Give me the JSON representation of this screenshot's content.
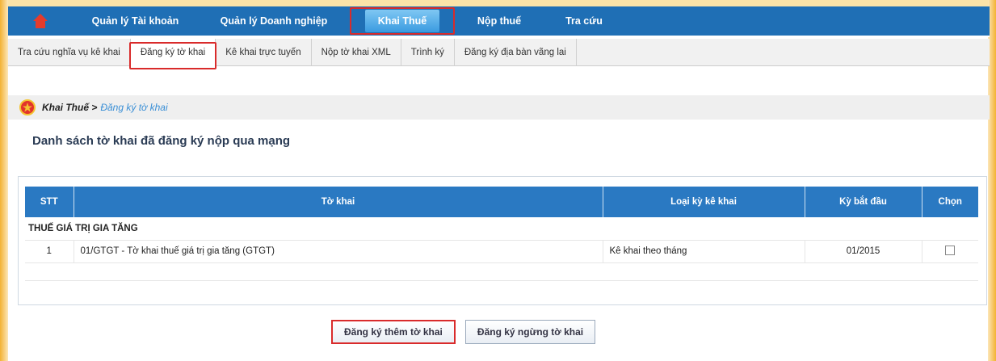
{
  "nav": {
    "items": [
      {
        "label": "Quản lý Tài khoản",
        "active": false
      },
      {
        "label": "Quản lý Doanh nghiệp",
        "active": false
      },
      {
        "label": "Khai Thuế",
        "active": true
      },
      {
        "label": "Nộp thuế",
        "active": false
      },
      {
        "label": "Tra cứu",
        "active": false
      }
    ]
  },
  "subnav": {
    "items": [
      {
        "label": "Tra cứu nghĩa vụ kê khai",
        "active": false
      },
      {
        "label": "Đăng ký tờ khai",
        "active": true
      },
      {
        "label": "Kê khai trực tuyến",
        "active": false
      },
      {
        "label": "Nộp tờ khai XML",
        "active": false
      },
      {
        "label": "Trình ký",
        "active": false
      },
      {
        "label": "Đăng ký địa bàn vãng lai",
        "active": false
      }
    ]
  },
  "breadcrumb": {
    "root": "Khai Thuế >",
    "current": "Đăng ký tờ khai"
  },
  "page_title": "Danh sách tờ khai đã đăng ký nộp qua mạng",
  "table": {
    "headers": [
      "STT",
      "Tờ khai",
      "Loại kỳ kê khai",
      "Kỳ bắt đầu",
      "Chọn"
    ],
    "group": "THUẾ GIÁ TRỊ GIA TĂNG",
    "rows": [
      {
        "stt": "1",
        "name": "01/GTGT - Tờ khai thuế giá trị gia tăng (GTGT)",
        "period_type": "Kê khai theo tháng",
        "start": "01/2015",
        "checked": false
      }
    ]
  },
  "buttons": {
    "add": "Đăng ký thêm tờ khai",
    "stop": "Đăng ký ngừng tờ khai"
  },
  "icons": {
    "home": "home-icon",
    "emblem": "emblem-icon",
    "checkbox": "checkbox-icon"
  },
  "colors": {
    "nav": "#1f6fb5",
    "accent": "#d92b2b",
    "header": "#2a79c2"
  }
}
